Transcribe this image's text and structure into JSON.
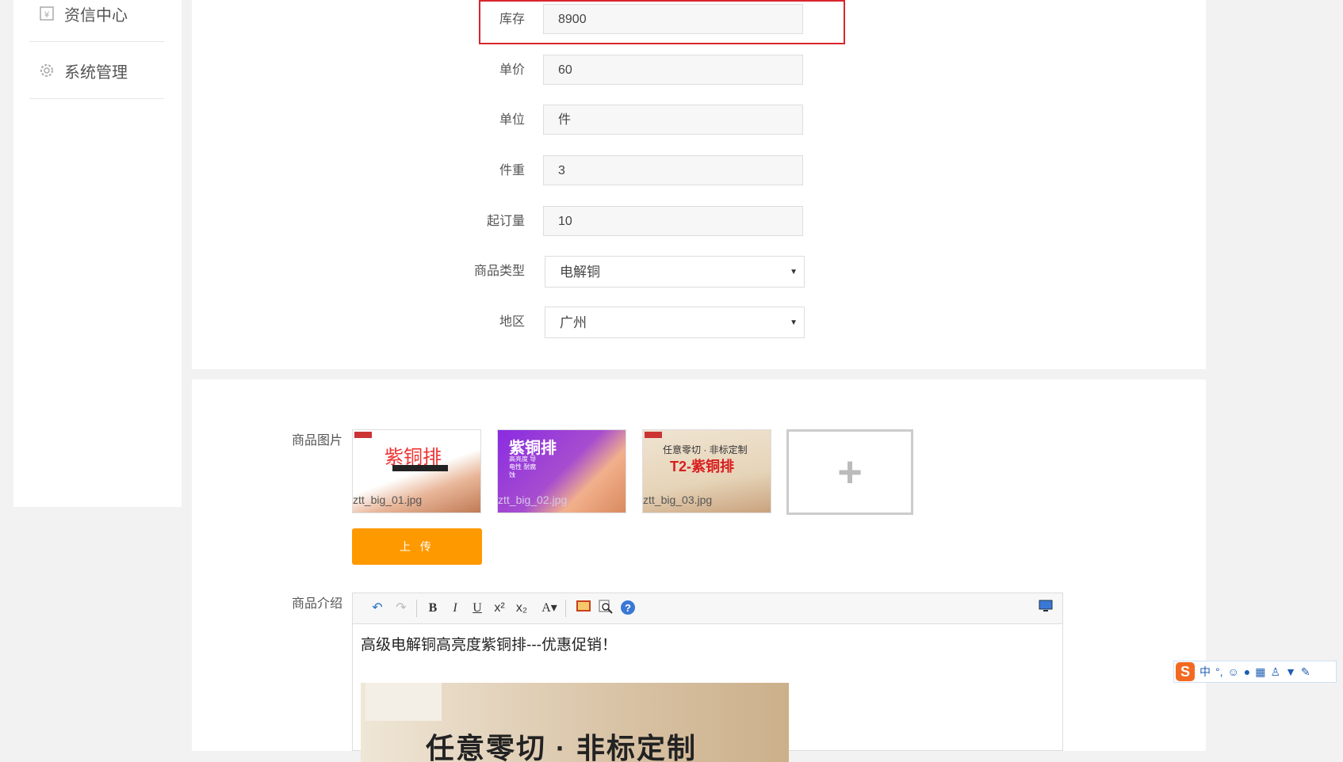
{
  "sidebar": {
    "items": [
      {
        "label": "资信中心",
        "icon": "yen-document-icon"
      },
      {
        "label": "系统管理",
        "icon": "gear-icon"
      }
    ]
  },
  "form": {
    "fields": [
      {
        "label": "库存",
        "value": "8900",
        "type": "input",
        "highlighted": true
      },
      {
        "label": "单价",
        "value": "60",
        "type": "input"
      },
      {
        "label": "单位",
        "value": "件",
        "type": "input"
      },
      {
        "label": "件重",
        "value": "3",
        "type": "input"
      },
      {
        "label": "起订量",
        "value": "10",
        "type": "input"
      },
      {
        "label": "商品类型",
        "value": "电解铜",
        "type": "select"
      },
      {
        "label": "地区",
        "value": "广州",
        "type": "select"
      }
    ]
  },
  "images": {
    "label": "商品图片",
    "thumbs": [
      {
        "filename": "ztt_big_01.jpg",
        "title": "紫铜排"
      },
      {
        "filename": "ztt_big_02.jpg",
        "title": "紫铜排",
        "subtitle": "高亮度 导电性 耐腐蚀"
      },
      {
        "filename": "ztt_big_03.jpg",
        "title": "T2-紫铜排",
        "subtitle": "任意零切 · 非标定制"
      }
    ],
    "add_symbol": "+",
    "upload_label": "上 传"
  },
  "editor": {
    "label": "商品介绍",
    "toolbar": [
      "undo-icon",
      "redo-icon",
      "bold-icon",
      "italic-icon",
      "underline-icon",
      "superscript-icon",
      "subscript-icon",
      "font-color-icon",
      "insert-image-icon",
      "preview-icon",
      "help-icon",
      "fullscreen-icon"
    ],
    "content_text": "高级电解铜高亮度紫铜排---优惠促销！",
    "content_image_text": "任意零切 · 非标定制"
  },
  "ime": {
    "label": "中"
  },
  "colors": {
    "accent": "#ff9900",
    "highlight": "#d9262c"
  }
}
